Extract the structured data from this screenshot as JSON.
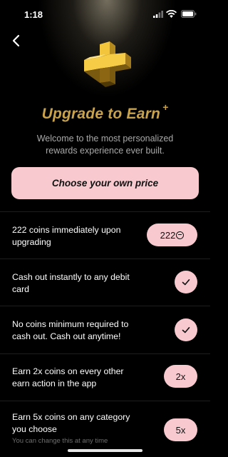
{
  "status": {
    "time": "1:18"
  },
  "header": {
    "title": "Upgrade to Earn",
    "title_mark": "+",
    "subtitle": "Welcome to the most personalized rewards experience ever built."
  },
  "cta": {
    "label": "Choose your own price"
  },
  "benefits": [
    {
      "text": "222 coins immediately upon upgrading",
      "badge": "222",
      "badge_icon": "coin-icon"
    },
    {
      "text": "Cash out instantly to any debit card",
      "badge_icon": "check-icon"
    },
    {
      "text": "No coins minimum required to cash out. Cash out anytime!",
      "badge_icon": "check-icon"
    },
    {
      "text": "Earn 2x coins on every other earn action in the app",
      "badge": "2x"
    },
    {
      "text": "Earn 5x coins on any category you choose",
      "note": "You can change this at any time",
      "badge": "5x"
    }
  ],
  "colors": {
    "accent_pink": "#f8c9cf",
    "gold": "#c9a24a",
    "background": "#000000"
  }
}
